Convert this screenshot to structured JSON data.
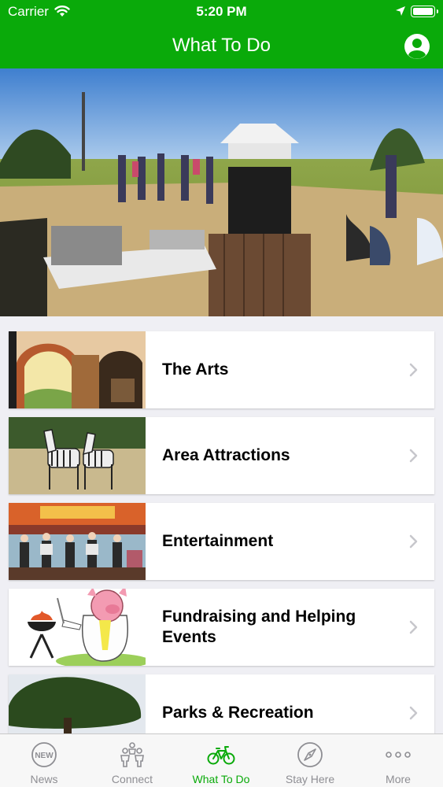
{
  "status_bar": {
    "carrier": "Carrier",
    "time": "5:20 PM"
  },
  "nav": {
    "title": "What To Do"
  },
  "list": {
    "items": [
      {
        "label": "The Arts"
      },
      {
        "label": "Area Attractions"
      },
      {
        "label": "Entertainment"
      },
      {
        "label": "Fundraising and Helping Events"
      },
      {
        "label": "Parks & Recreation"
      }
    ]
  },
  "tabs": [
    {
      "label": "News",
      "icon": "news-icon"
    },
    {
      "label": "Connect",
      "icon": "people-icon"
    },
    {
      "label": "What To Do",
      "icon": "bicycle-icon",
      "active": true
    },
    {
      "label": "Stay Here",
      "icon": "compass-icon"
    },
    {
      "label": "More",
      "icon": "more-dots-icon"
    }
  ],
  "colors": {
    "brand_green": "#0aaa0a",
    "tab_inactive": "#8e8e93"
  }
}
